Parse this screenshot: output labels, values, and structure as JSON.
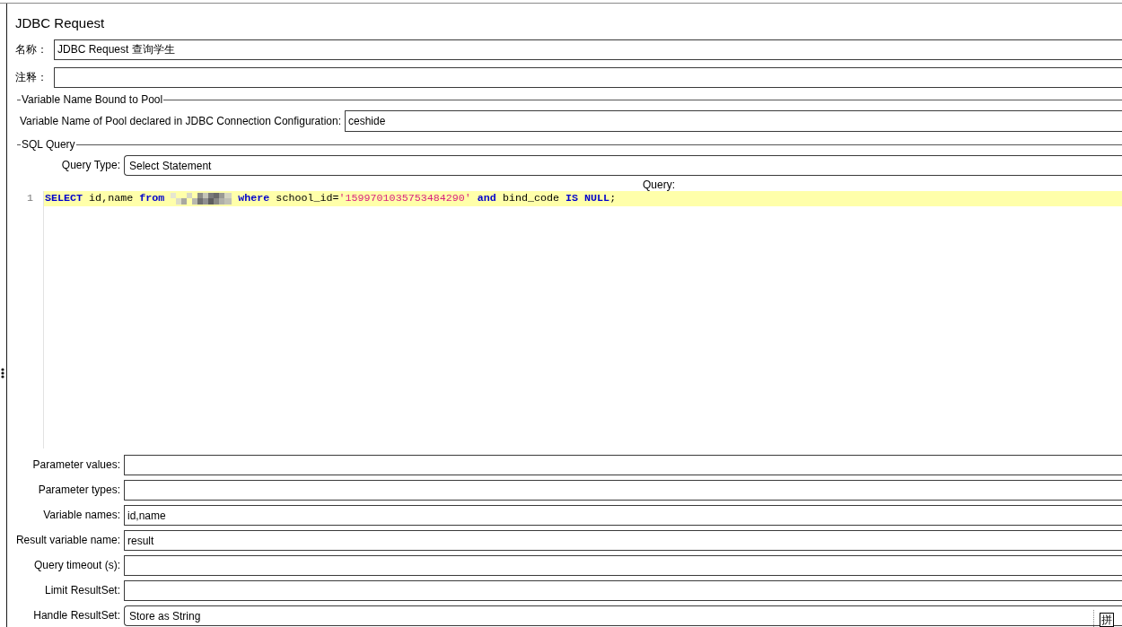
{
  "panel_title": "JDBC Request",
  "fields": [
    {
      "label": "名称：",
      "value": "JDBC Request 查询学生"
    },
    {
      "label": "注释："
    }
  ],
  "pool_group": {
    "legend": "Variable Name Bound to Pool",
    "label": "Variable Name of Pool declared in JDBC Connection Configuration:",
    "value": "ceshide"
  },
  "sql_group": {
    "legend": "SQL Query",
    "query_type": {
      "label": "Query Type:",
      "value": "Select Statement",
      "kind": "select"
    },
    "query_label": "Query:",
    "editor": {
      "lines": [
        {
          "number": "1",
          "highlighted": true,
          "segments": [
            {
              "kind": "code",
              "tokens": [
                {
                  "kind": "keyword",
                  "text": "SELECT"
                },
                {
                  "kind": "plain",
                  "text": " id,name "
                },
                {
                  "kind": "keyword",
                  "text": "from"
                }
              ]
            },
            {
              "kind": "redacted"
            },
            {
              "kind": "code",
              "tokens": [
                {
                  "kind": "keyword",
                  "text": "where"
                },
                {
                  "kind": "plain",
                  "text": " school_id="
                },
                {
                  "kind": "string",
                  "text": "'1599701035753484290'"
                },
                {
                  "kind": "keyword",
                  "text": " and"
                },
                {
                  "kind": "plain",
                  "text": " bind_code "
                },
                {
                  "kind": "keyword",
                  "text": "IS NULL"
                },
                {
                  "kind": "plain",
                  "text": ";"
                }
              ]
            }
          ]
        }
      ]
    }
  },
  "parameters": [
    {
      "label": "Parameter values:",
      "kind": "text"
    },
    {
      "label": "Parameter types:",
      "kind": "text"
    },
    {
      "label": "Variable names:",
      "value": "id,name",
      "kind": "text"
    },
    {
      "label": "Result variable name:",
      "value": "result",
      "kind": "text"
    },
    {
      "label": "Query timeout (s):",
      "kind": "text"
    },
    {
      "label": "Limit ResultSet:",
      "kind": "text"
    },
    {
      "label": "Handle ResultSet:",
      "value": "Store as String",
      "kind": "select"
    }
  ],
  "ime_indicator": "拼"
}
